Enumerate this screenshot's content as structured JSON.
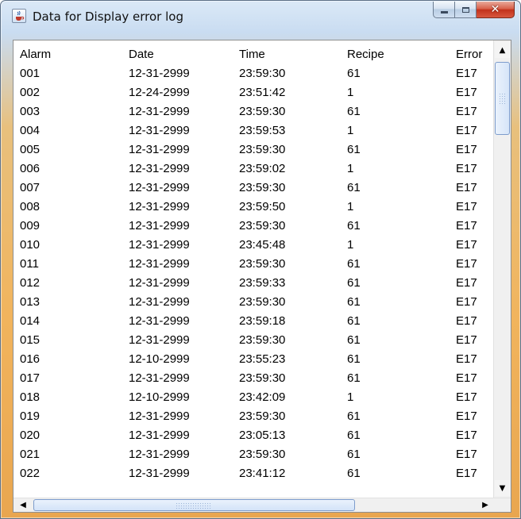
{
  "window": {
    "title": "Data for Display error log",
    "icon": "java-cup-icon"
  },
  "table": {
    "columns": [
      "Alarm",
      "Date",
      "Time",
      "Recipe",
      "Error"
    ],
    "rows": [
      [
        "001",
        "12-31-2999",
        "23:59:30",
        "61",
        "E17"
      ],
      [
        "002",
        "12-24-2999",
        "23:51:42",
        "1",
        "E17"
      ],
      [
        "003",
        "12-31-2999",
        "23:59:30",
        "61",
        "E17"
      ],
      [
        "004",
        "12-31-2999",
        "23:59:53",
        "1",
        "E17"
      ],
      [
        "005",
        "12-31-2999",
        "23:59:30",
        "61",
        "E17"
      ],
      [
        "006",
        "12-31-2999",
        "23:59:02",
        "1",
        "E17"
      ],
      [
        "007",
        "12-31-2999",
        "23:59:30",
        "61",
        "E17"
      ],
      [
        "008",
        "12-31-2999",
        "23:59:50",
        "1",
        "E17"
      ],
      [
        "009",
        "12-31-2999",
        "23:59:30",
        "61",
        "E17"
      ],
      [
        "010",
        "12-31-2999",
        "23:45:48",
        "1",
        "E17"
      ],
      [
        "011",
        "12-31-2999",
        "23:59:30",
        "61",
        "E17"
      ],
      [
        "012",
        "12-31-2999",
        "23:59:33",
        "61",
        "E17"
      ],
      [
        "013",
        "12-31-2999",
        "23:59:30",
        "61",
        "E17"
      ],
      [
        "014",
        "12-31-2999",
        "23:59:18",
        "61",
        "E17"
      ],
      [
        "015",
        "12-31-2999",
        "23:59:30",
        "61",
        "E17"
      ],
      [
        "016",
        "12-10-2999",
        "23:55:23",
        "61",
        "E17"
      ],
      [
        "017",
        "12-31-2999",
        "23:59:30",
        "61",
        "E17"
      ],
      [
        "018",
        "12-10-2999",
        "23:42:09",
        "1",
        "E17"
      ],
      [
        "019",
        "12-31-2999",
        "23:59:30",
        "61",
        "E17"
      ],
      [
        "020",
        "12-31-2999",
        "23:05:13",
        "61",
        "E17"
      ],
      [
        "021",
        "12-31-2999",
        "23:59:30",
        "61",
        "E17"
      ],
      [
        "022",
        "12-31-2999",
        "23:41:12",
        "61",
        "E17"
      ]
    ]
  },
  "scrollbars": {
    "vertical_position": 0.05,
    "horizontal_position": 0.0
  },
  "colors": {
    "frame_top": "#c9dcf1",
    "frame_bottom": "#e9a64f",
    "close_button": "#c2321c",
    "scroll_thumb_border": "#7d9ccc"
  }
}
